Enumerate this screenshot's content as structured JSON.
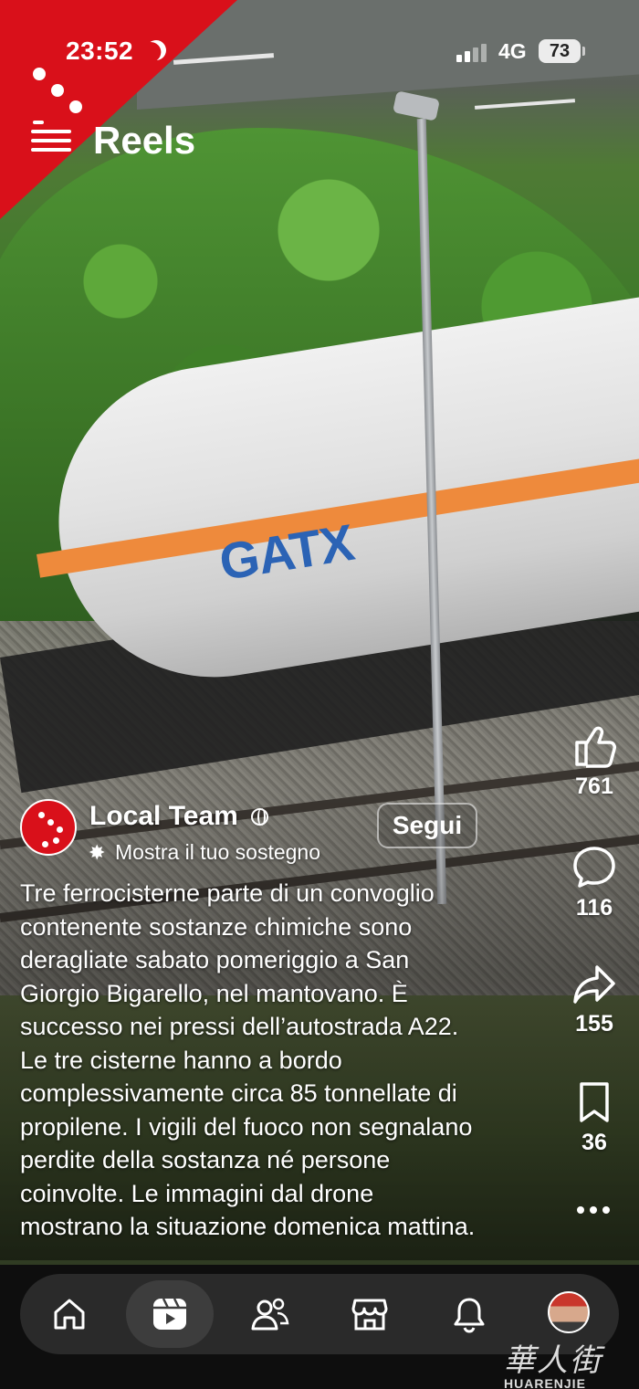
{
  "status_bar": {
    "time": "23:52",
    "network": "4G",
    "battery": "73"
  },
  "header": {
    "title": "Reels"
  },
  "actions": {
    "likes": "761",
    "comments": "116",
    "shares": "155",
    "saves": "36"
  },
  "author": {
    "name": "Local Team",
    "follow_label": "Segui",
    "support_label": "Mostra il tuo sostegno"
  },
  "caption": {
    "lines": [
      "Tre ferrocisterne parte di un convoglio",
      "contenente sostanze chimiche sono",
      "deragliate sabato pomeriggio a San",
      "Giorgio Bigarello, nel mantovano. È",
      "successo nei pressi dell’autostrada A22.",
      "Le tre cisterne hanno a bordo",
      "complessivamente circa 85 tonnellate di",
      "propilene. I vigili del fuoco non segnalano",
      "perdite della sostanza né persone",
      "coinvolte. Le immagini dal drone",
      "mostrano la situazione domenica mattina."
    ]
  },
  "scene": {
    "tank_logo": "GATX"
  },
  "nav": {
    "items": [
      {
        "icon": "home-icon"
      },
      {
        "icon": "reels-icon",
        "active": true
      },
      {
        "icon": "friends-icon"
      },
      {
        "icon": "marketplace-icon"
      },
      {
        "icon": "notifications-icon"
      },
      {
        "icon": "profile-avatar"
      }
    ]
  },
  "watermark": {
    "logo": "華人街",
    "text": "HUARENJIE"
  },
  "colors": {
    "brand_red": "#d9101a",
    "tank_stripe": "#ee8a3c",
    "gatx_blue": "#2b63b5",
    "nav_bg": "#2a2a2a"
  }
}
